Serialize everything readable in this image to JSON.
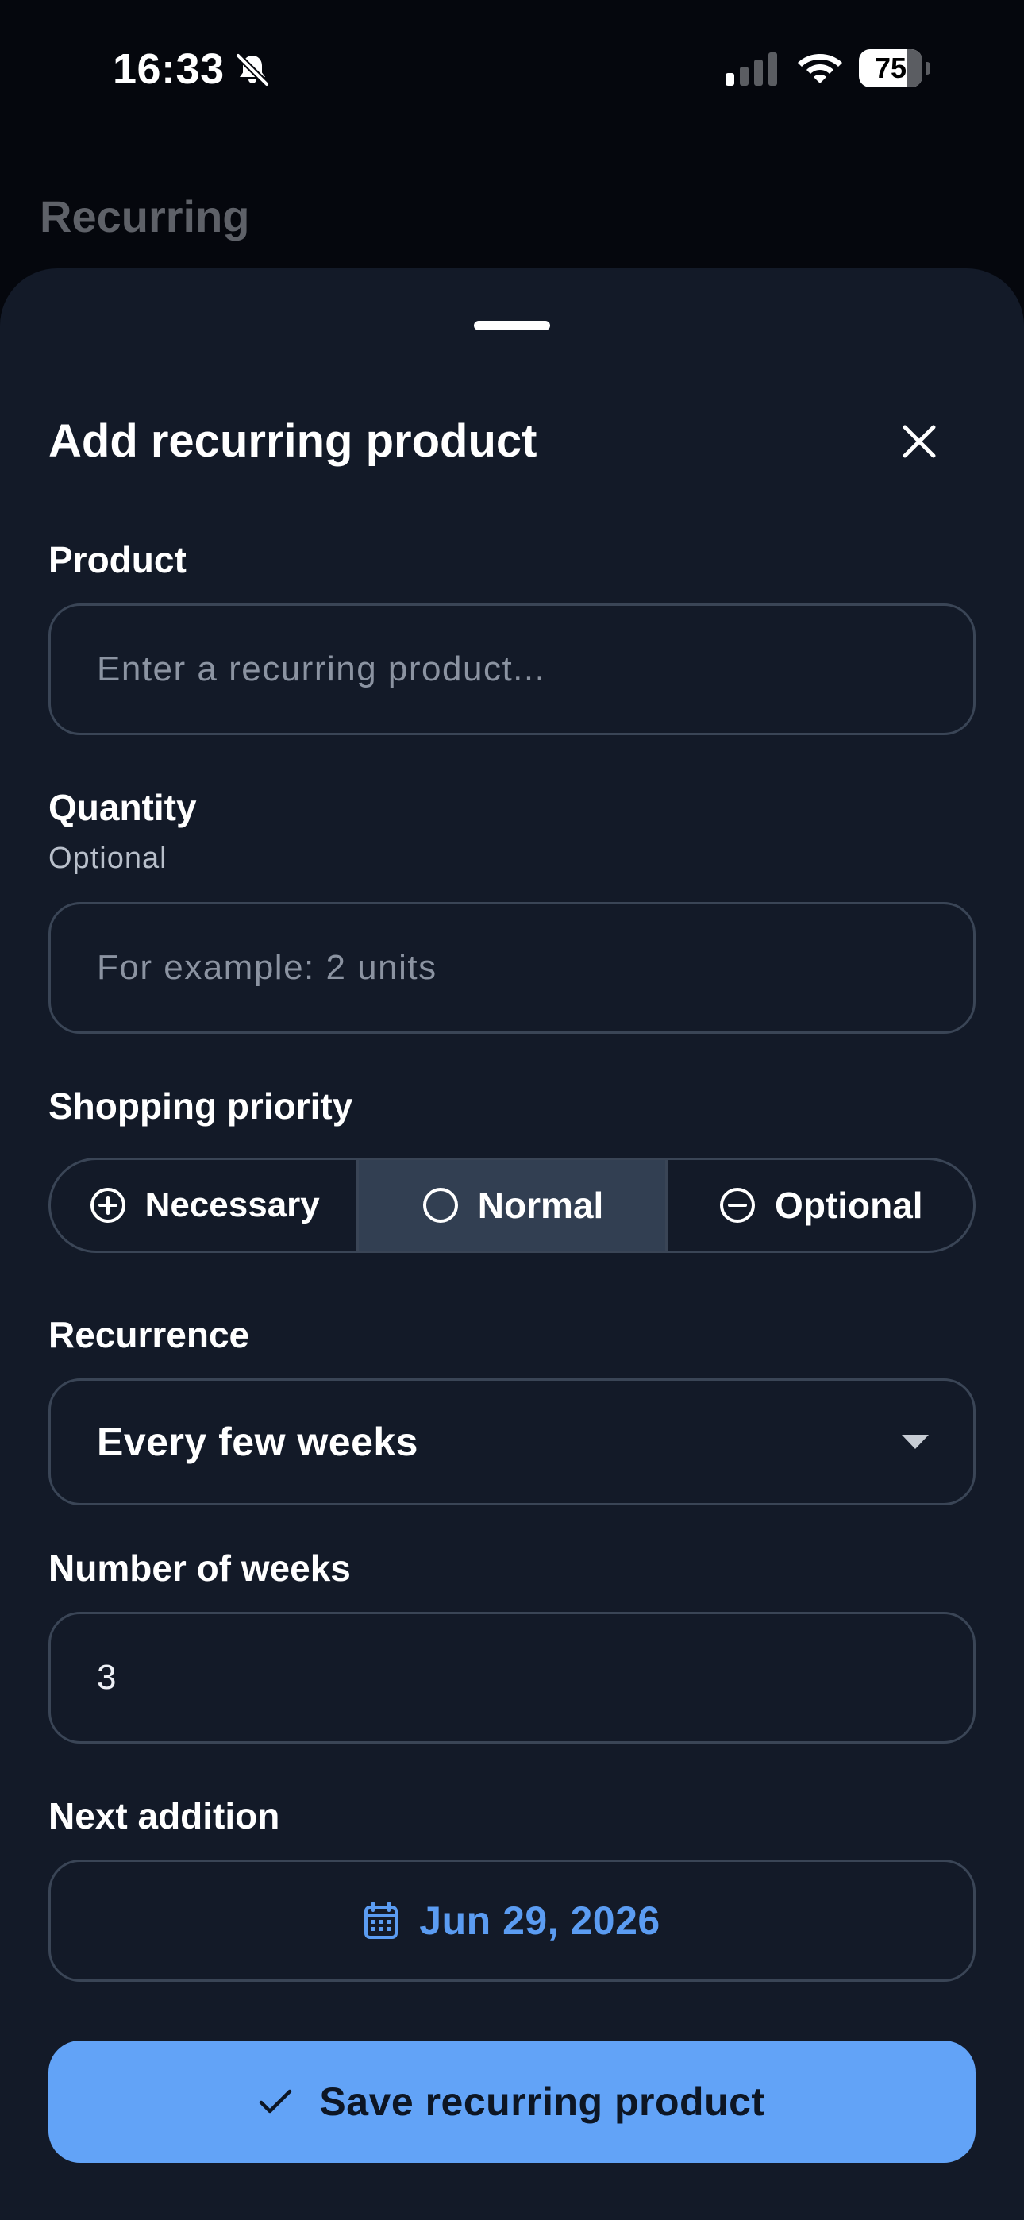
{
  "status_bar": {
    "time": "16:33",
    "battery": "75"
  },
  "background": {
    "title": "Recurring"
  },
  "sheet": {
    "title": "Add recurring product",
    "product": {
      "label": "Product",
      "placeholder": "Enter a recurring product..."
    },
    "quantity": {
      "label": "Quantity",
      "sublabel": "Optional",
      "placeholder": "For example: 2 units"
    },
    "priority": {
      "label": "Shopping priority",
      "options": [
        {
          "label": "Necessary",
          "icon": "plus-circle-icon"
        },
        {
          "label": "Normal",
          "icon": "circle-icon",
          "selected": true
        },
        {
          "label": "Optional",
          "icon": "minus-circle-icon"
        }
      ]
    },
    "recurrence": {
      "label": "Recurrence",
      "value": "Every few weeks"
    },
    "weeks": {
      "label": "Number of weeks",
      "value": "3"
    },
    "next_addition": {
      "label": "Next addition",
      "date": "Jun 29, 2026"
    },
    "save_label": "Save recurring product"
  },
  "colors": {
    "sheet_bg": "#131a28",
    "accent": "#62a3f7",
    "date_text": "#5b9cf2",
    "selected_segment": "#323f52"
  }
}
